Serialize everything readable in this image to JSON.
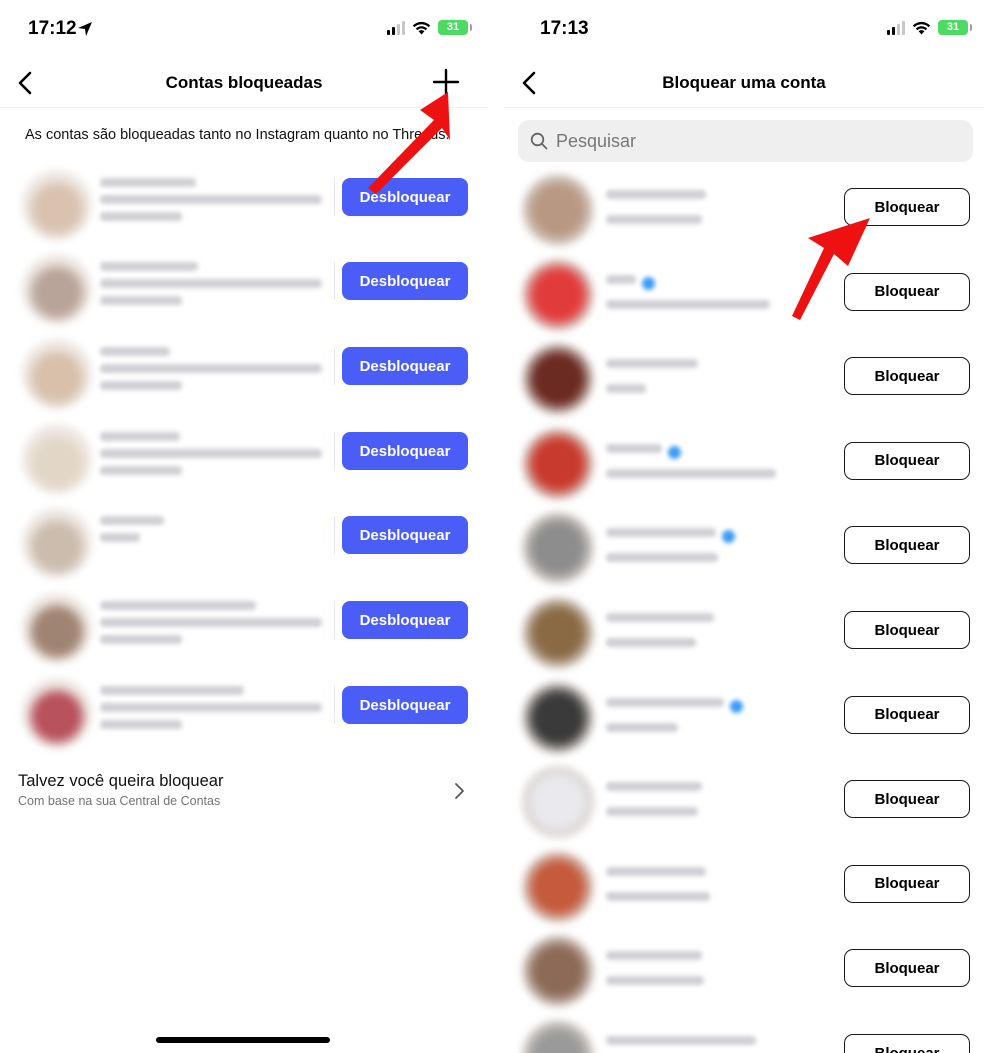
{
  "left": {
    "status": {
      "time": "17:12",
      "battery": "31"
    },
    "nav": {
      "title": "Contas bloqueadas"
    },
    "info_text": "As contas são bloqueadas tanto no Instagram quanto no Threads.",
    "unblock_label": "Desbloquear",
    "blocked_count": 7,
    "suggestion": {
      "title": "Talvez você queira bloquear",
      "subtitle": "Com base na sua Central de Contas"
    }
  },
  "right": {
    "status": {
      "time": "17:13",
      "battery": "31"
    },
    "nav": {
      "title": "Bloquear uma conta"
    },
    "search": {
      "placeholder": "Pesquisar"
    },
    "block_label": "Bloquear",
    "accounts_count": 11
  },
  "colors": {
    "primary_button": "#4a5df6",
    "annotation_arrow": "#ee1111",
    "battery": "#4cd964",
    "verified": "#3b9cf5"
  }
}
